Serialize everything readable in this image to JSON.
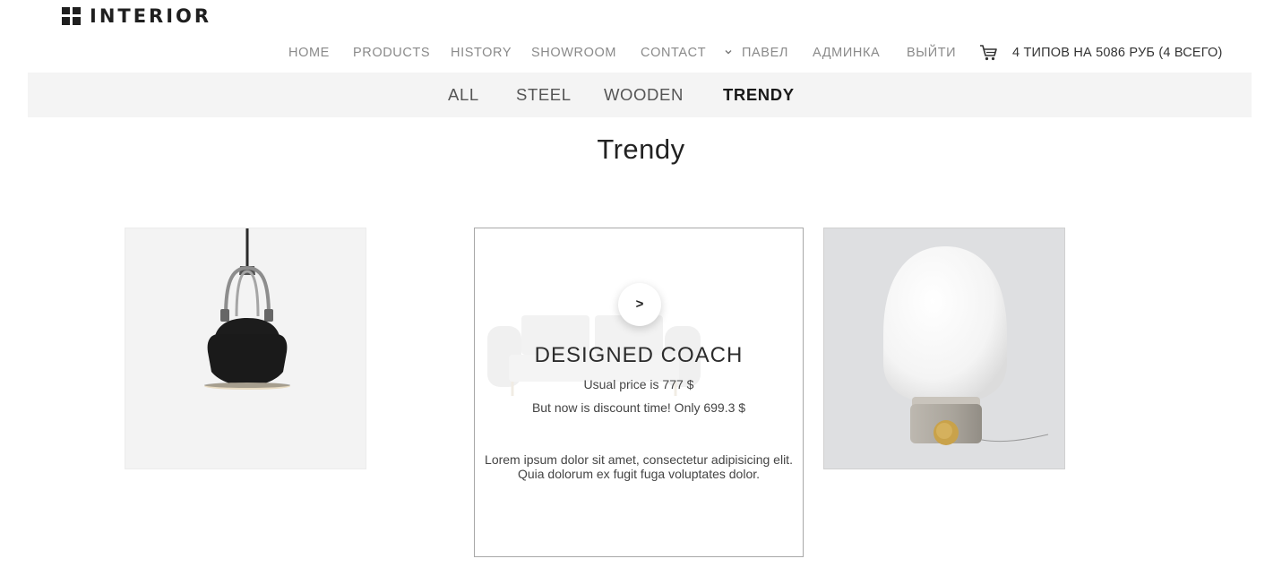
{
  "brand": {
    "name": "INTERIOR"
  },
  "nav": {
    "items": [
      "HOME",
      "PRODUCTS",
      "HISTORY",
      "SHOWROOM",
      "CONTACT"
    ],
    "user": "ПАВЕЛ",
    "admin": "АДМИНКА",
    "logout": "ВЫЙТИ",
    "cart_summary": "4 ТИПОВ НА 5086 РУБ (4 ВСЕГО)"
  },
  "categories": {
    "items": [
      "ALL",
      "STEEL",
      "WOODEN",
      "TRENDY"
    ],
    "active": "TRENDY"
  },
  "page": {
    "title": "Trendy"
  },
  "products": {
    "featured": {
      "title": "DESIGNED COACH",
      "price_line": "Usual price is 777 $",
      "discount_line": "But now is discount time! Only 699.3 $",
      "description": "Lorem ipsum dolor sit amet, consectetur adipisicing elit. Quia dolorum ex fugit fuga voluptates dolor.",
      "next_label": ">"
    }
  },
  "icons": {
    "logo": "grid-logo-icon",
    "chevron": "chevron-down-icon",
    "cart": "cart-icon",
    "lamp1": "pendant-lamp-image",
    "lamp2": "table-lamp-image",
    "sofa": "sofa-image"
  },
  "colors": {
    "nav_text": "#8a8a8a",
    "active_category": "#1a1a1a",
    "category_bar": "#f4f4f4",
    "brass": "#c9a24a"
  }
}
